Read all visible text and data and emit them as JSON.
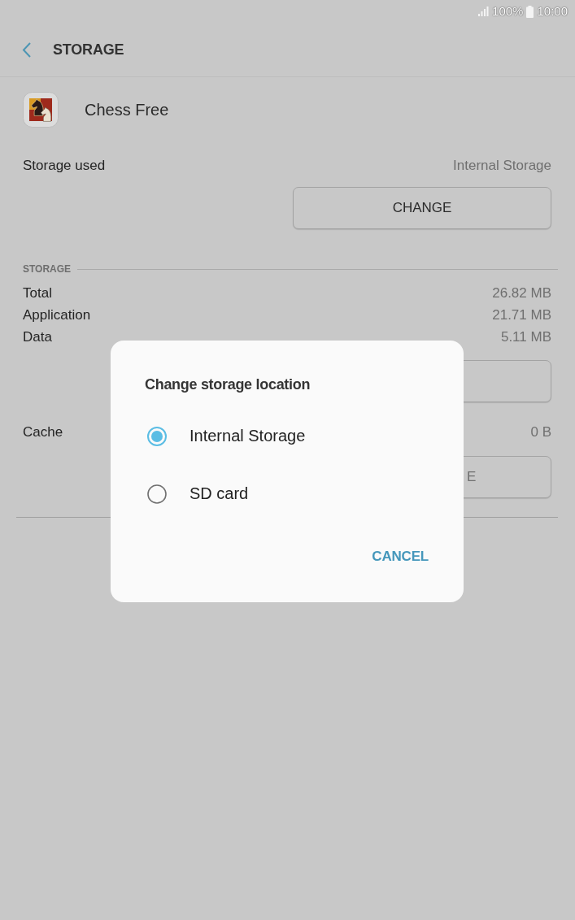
{
  "status_bar": {
    "battery": "100%",
    "time": "10:00"
  },
  "header": {
    "title": "STORAGE"
  },
  "app": {
    "name": "Chess Free"
  },
  "storage_used": {
    "label": "Storage used",
    "value": "Internal Storage",
    "button": "CHANGE"
  },
  "storage": {
    "title": "STORAGE",
    "rows": [
      {
        "label": "Total",
        "value": "26.82 MB"
      },
      {
        "label": "Application",
        "value": "21.71 MB"
      },
      {
        "label": "Data",
        "value": "5.11 MB"
      }
    ]
  },
  "cache": {
    "label": "Cache",
    "value": "0 B",
    "button": {
      "label": "E",
      "disabled": true
    }
  },
  "dialog": {
    "title": "Change storage location",
    "options": [
      {
        "label": "Internal Storage",
        "selected": true
      },
      {
        "label": "SD card",
        "selected": false
      }
    ],
    "button": "CANCEL"
  }
}
